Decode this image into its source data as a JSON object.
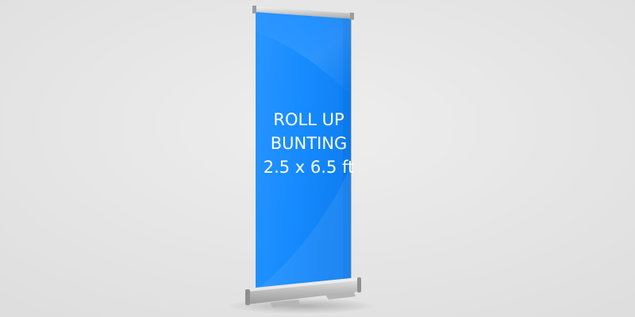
{
  "banner": {
    "line1": "ROLL UP",
    "line2": "BUNTING",
    "line3": "2.5 x 6.5 ft"
  },
  "colors": {
    "background": "#e5e5e5",
    "banner_blue": "#1a8cff",
    "banner_blue_dark": "#0d6fe0",
    "metal": "#c9c9c9",
    "text": "#ffffff"
  }
}
